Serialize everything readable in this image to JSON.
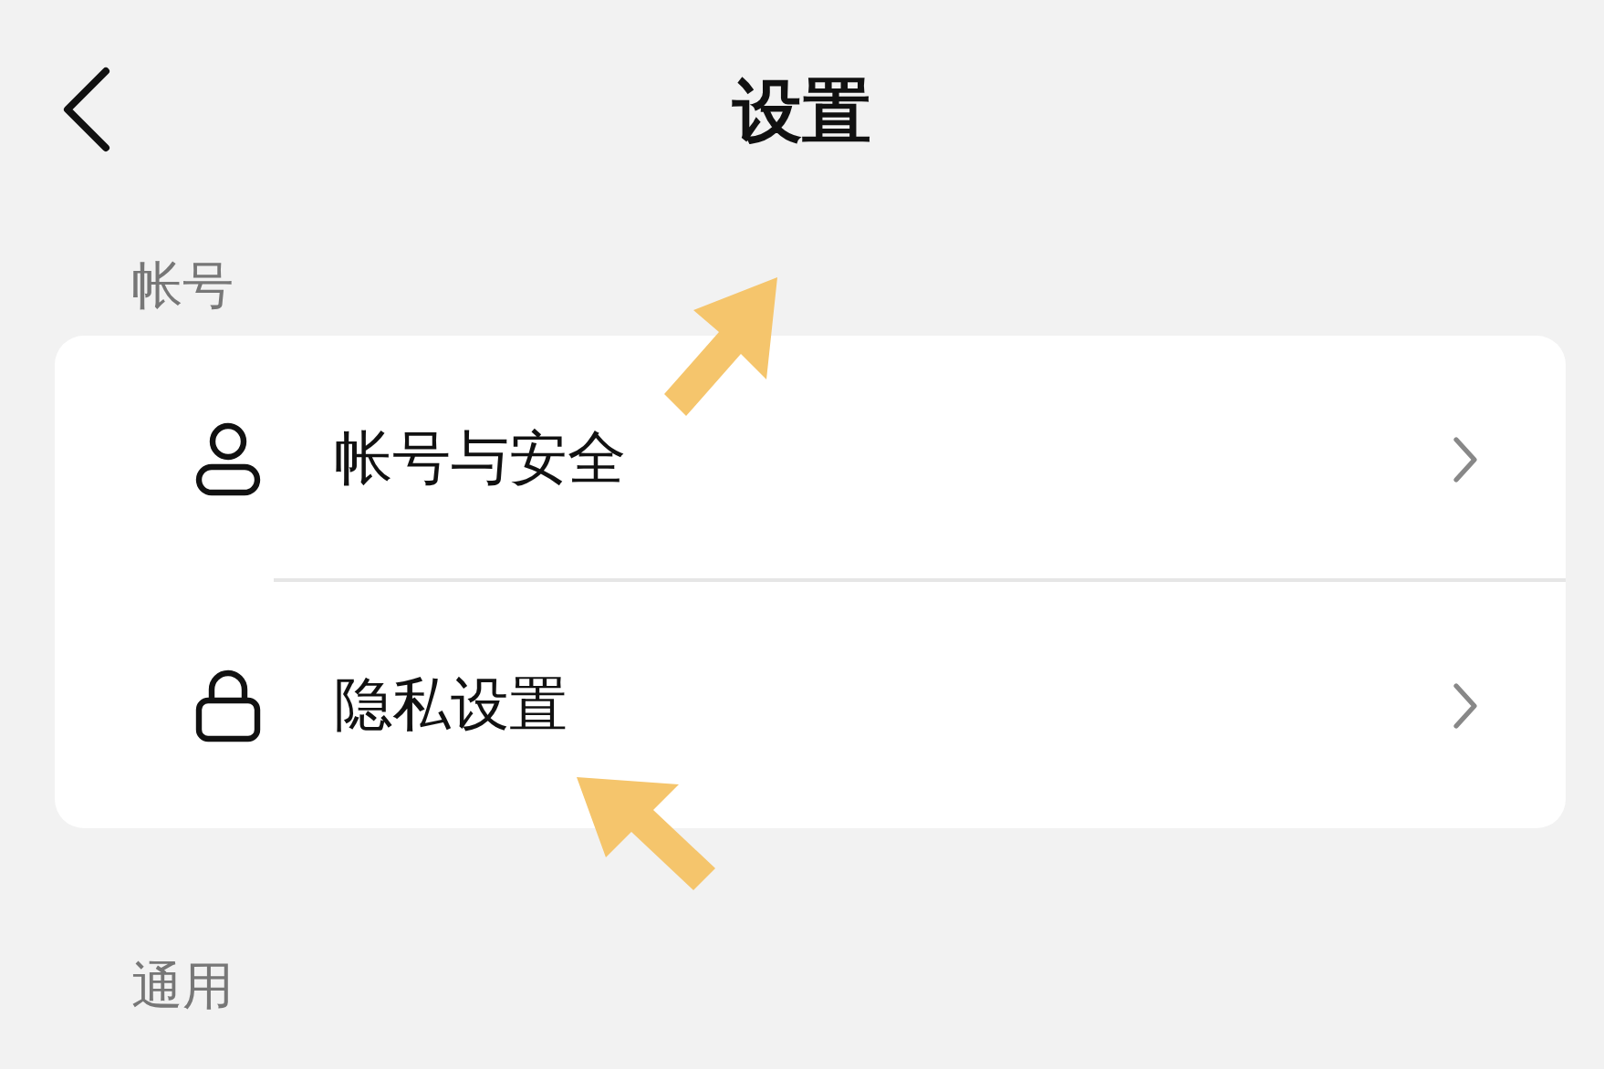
{
  "header": {
    "title": "设置",
    "pointed_at": true
  },
  "sections": [
    {
      "label": "帐号",
      "items": [
        {
          "kind": "person",
          "label": "帐号与安全",
          "pointed_at": false
        },
        {
          "kind": "lock",
          "label": "隐私设置",
          "pointed_at": true
        }
      ]
    },
    {
      "label": "通用"
    }
  ]
}
